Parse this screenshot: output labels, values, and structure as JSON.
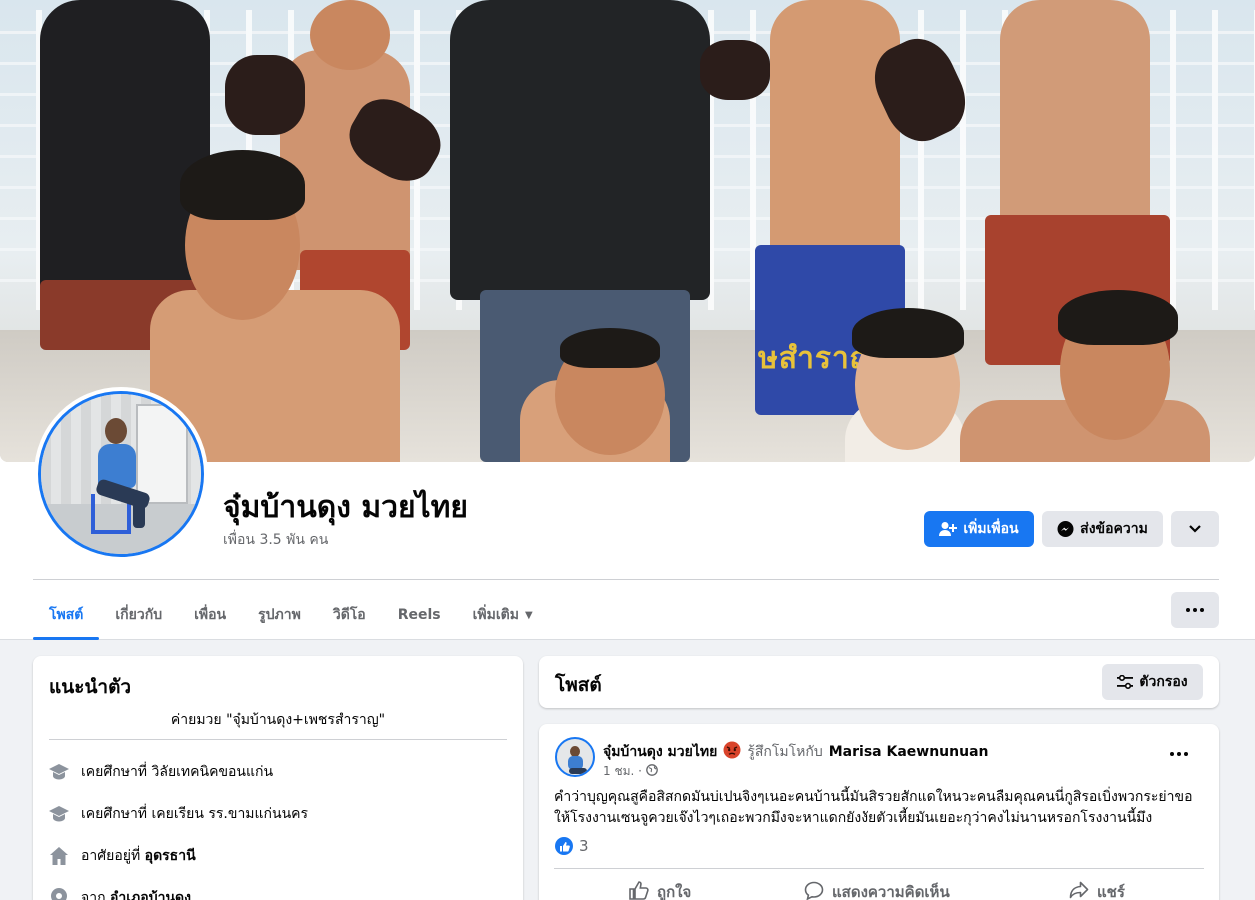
{
  "profile": {
    "name": "จุ๋มบ้านดุง มวยไทย",
    "friends": "เพื่อน 3.5 พัน คน",
    "cover_text": "ษสำราญ"
  },
  "actions": {
    "add_friend": "เพิ่มเพื่อน",
    "message": "ส่งข้อความ"
  },
  "tabs": [
    {
      "label": "โพสต์"
    },
    {
      "label": "เกี่ยวกับ"
    },
    {
      "label": "เพื่อน"
    },
    {
      "label": "รูปภาพ"
    },
    {
      "label": "วิดีโอ"
    },
    {
      "label": "Reels"
    },
    {
      "label": "เพิ่มเติม"
    }
  ],
  "intro": {
    "title": "แนะนำตัว",
    "bio": "ค่ายมวย \"จุ๋มบ้านดุง+เพชรสำราญ\"",
    "items": [
      {
        "prefix": "เคยศึกษาที่ ",
        "value": "วิลัยเทคนิคขอนแก่น",
        "icon": "graduation-cap-icon"
      },
      {
        "prefix": "เคยศึกษาที่ ",
        "value": "เคยเรียน รร.ขามแก่นนคร",
        "icon": "graduation-cap-icon"
      },
      {
        "prefix": "อาศัยอยู่ที่ ",
        "value": "อุดรธานี",
        "icon": "home-icon"
      },
      {
        "prefix": "จาก ",
        "value": "อำเภอบ้านดุง",
        "icon": "location-pin-icon"
      }
    ]
  },
  "posts_header": {
    "title": "โพสต์",
    "filter": "ตัวกรอง"
  },
  "post": {
    "author": "จุ๋มบ้านดุง มวยไทย",
    "feeling": "รู้สึกโมโหกับ",
    "tagged": "Marisa Kaewnunuan",
    "time": "1 ชม. ·",
    "text_lines": [
      "คำว่าบุญคุณสูคือสิสกดมันบ่เปนจิงๆเนอะคนบ้านนี้มันสิรวยสักแดใหนวะคนลืมคุณคนนี่กูสิรอเบิ่งพวกระย่าขอ",
      "ให้โรงงานเซนจูควยเจ๊งไวๆเถอะพวกมึงจะหาแดกยังงัยตัวเหี้ยมันเยอะกุว่าคงไม่นานหรอกโรงงานนี้มึง"
    ],
    "reaction_count": "3",
    "actions": {
      "like": "ถูกใจ",
      "comment": "แสดงความคิดเห็น",
      "share": "แชร์"
    }
  },
  "colors": {
    "accent": "#1877f2",
    "background": "#f0f2f5",
    "secondary_text": "#65676b"
  }
}
